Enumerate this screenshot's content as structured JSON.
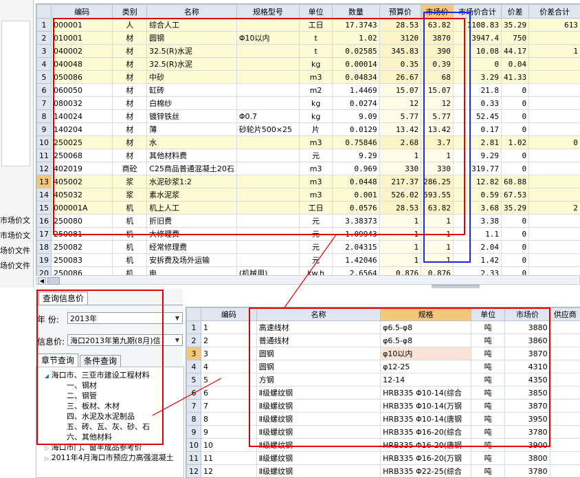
{
  "left_panel": {
    "file_labels": [
      "市场价文",
      "市场价文",
      "场价文件",
      "场价文件"
    ]
  },
  "main_grid": {
    "headers": [
      "编码",
      "类别",
      "名称",
      "规格型号",
      "单位",
      "数量",
      "预算价",
      "市场价",
      "市场价合计",
      "价差",
      "价差合计"
    ],
    "rows": [
      {
        "no": "1",
        "code": "000001",
        "cat": "人",
        "name": "综合人工",
        "spec": "",
        "unit": "工日",
        "qty": "17.3743",
        "budget": "28.53",
        "market": "63.82",
        "market_total": "1108.83",
        "diff": "35.29",
        "diff_total": "613"
      },
      {
        "no": "2",
        "code": "010001",
        "cat": "材",
        "name": "圆钢",
        "spec": "Φ10以内",
        "unit": "t",
        "qty": "1.02",
        "budget": "3120",
        "market": "3870",
        "market_total": "3947.4",
        "diff": "750",
        "diff_total": ""
      },
      {
        "no": "3",
        "code": "040002",
        "cat": "材",
        "name": "32.5(R)水泥",
        "spec": "",
        "unit": "t",
        "qty": "0.02585",
        "budget": "345.83",
        "market": "390",
        "market_total": "10.08",
        "diff": "44.17",
        "diff_total": "1"
      },
      {
        "no": "4",
        "code": "040048",
        "cat": "材",
        "name": "32.5(R)水泥",
        "spec": "",
        "unit": "kg",
        "qty": "0.00014",
        "budget": "0.35",
        "market": "0.39",
        "market_total": "0",
        "diff": "0.04",
        "diff_total": ""
      },
      {
        "no": "5",
        "code": "050086",
        "cat": "材",
        "name": "中砂",
        "spec": "",
        "unit": "m3",
        "qty": "0.04834",
        "budget": "26.67",
        "market": "68",
        "market_total": "3.29",
        "diff": "41.33",
        "diff_total": ""
      },
      {
        "no": "6",
        "code": "060050",
        "cat": "材",
        "name": "缸砖",
        "spec": "",
        "unit": "m2",
        "qty": "1.4469",
        "budget": "15.07",
        "market": "15.07",
        "market_total": "21.8",
        "diff": "0",
        "diff_total": ""
      },
      {
        "no": "7",
        "code": "080032",
        "cat": "材",
        "name": "白棉纱",
        "spec": "",
        "unit": "kg",
        "qty": "0.0274",
        "budget": "12",
        "market": "12",
        "market_total": "0.33",
        "diff": "0",
        "diff_total": ""
      },
      {
        "no": "8",
        "code": "140024",
        "cat": "材",
        "name": "镀锌铁丝",
        "spec": "Φ0.7",
        "unit": "kg",
        "qty": "9.09",
        "budget": "5.77",
        "market": "5.77",
        "market_total": "52.45",
        "diff": "0",
        "diff_total": ""
      },
      {
        "no": "9",
        "code": "140204",
        "cat": "材",
        "name": "薄",
        "spec": "砂轮片500×25",
        "unit": "片",
        "qty": "0.0129",
        "budget": "13.42",
        "market": "13.42",
        "market_total": "0.17",
        "diff": "0",
        "diff_total": ""
      },
      {
        "no": "10",
        "code": "250025",
        "cat": "材",
        "name": "水",
        "spec": "",
        "unit": "m3",
        "qty": "0.75846",
        "budget": "2.68",
        "market": "3.7",
        "market_total": "2.81",
        "diff": "1.02",
        "diff_total": "0"
      },
      {
        "no": "11",
        "code": "250068",
        "cat": "材",
        "name": "其他材料费",
        "spec": "",
        "unit": "元",
        "qty": "9.29",
        "budget": "1",
        "market": "1",
        "market_total": "9.29",
        "diff": "0",
        "diff_total": ""
      },
      {
        "no": "12",
        "code": "402019",
        "cat": "商砼",
        "name": "C25商品普通混凝土20石",
        "spec": "",
        "unit": "m3",
        "qty": "0.969",
        "budget": "330",
        "market": "330",
        "market_total": "319.77",
        "diff": "0",
        "diff_total": ""
      },
      {
        "no": "13",
        "code": "405002",
        "cat": "浆",
        "name": "水泥砂浆1:2",
        "spec": "",
        "unit": "m3",
        "qty": "0.0448",
        "budget": "217.37",
        "market": "286.25",
        "market_total": "12.82",
        "diff": "68.88",
        "diff_total": ""
      },
      {
        "no": "14",
        "code": "405032",
        "cat": "浆",
        "name": "素水泥浆",
        "spec": "",
        "unit": "m3",
        "qty": "0.001",
        "budget": "526.02",
        "market": "593.55",
        "market_total": "0.59",
        "diff": "67.53",
        "diff_total": ""
      },
      {
        "no": "15",
        "code": "000001A",
        "cat": "机",
        "name": "机上人工",
        "spec": "",
        "unit": "工日",
        "qty": "0.0576",
        "budget": "28.53",
        "market": "63.82",
        "market_total": "3.68",
        "diff": "35.29",
        "diff_total": "2"
      },
      {
        "no": "16",
        "code": "250080",
        "cat": "机",
        "name": "折旧费",
        "spec": "",
        "unit": "元",
        "qty": "3.38373",
        "budget": "1",
        "market": "1",
        "market_total": "3.38",
        "diff": "0",
        "diff_total": ""
      },
      {
        "no": "17",
        "code": "250081",
        "cat": "机",
        "name": "大修理费",
        "spec": "",
        "unit": "元",
        "qty": "1.09943",
        "budget": "1",
        "market": "1",
        "market_total": "1.1",
        "diff": "0",
        "diff_total": ""
      },
      {
        "no": "18",
        "code": "250082",
        "cat": "机",
        "name": "经常修理费",
        "spec": "",
        "unit": "元",
        "qty": "2.04315",
        "budget": "1",
        "market": "1",
        "market_total": "2.04",
        "diff": "0",
        "diff_total": ""
      },
      {
        "no": "19",
        "code": "250083",
        "cat": "机",
        "name": "安拆费及场外运输",
        "spec": "",
        "unit": "元",
        "qty": "1.42046",
        "budget": "1",
        "market": "1",
        "market_total": "1.42",
        "diff": "0",
        "diff_total": ""
      },
      {
        "no": "20",
        "code": "250086",
        "cat": "机",
        "name": "电",
        "spec": "(机械用)",
        "unit": "kw.h",
        "qty": "2.6564",
        "budget": "0.876",
        "market": "0.876",
        "market_total": "2.33",
        "diff": "0",
        "diff_total": ""
      }
    ]
  },
  "query_panel": {
    "tab_label": "查询信息价",
    "year_label": "年  份:",
    "year_value": "2013年",
    "info_label": "信息价:",
    "info_value": "海口2013年第九期(8月)信",
    "subtabs": [
      "章节查询",
      "条件查询"
    ],
    "tree": {
      "root": "海口市、三亚市建设工程材料",
      "children": [
        "一、钢材",
        "二、钢管",
        "三、板材、木材",
        "四、水泥及水泥制品",
        "五、砖、瓦、灰、砂、石",
        "六、其他材料"
      ],
      "siblings": [
        "海口市门、窗半成品参考价",
        "2011年4月海口市预应力高强混凝土"
      ]
    }
  },
  "detail_grid": {
    "headers": [
      "编码",
      "名称",
      "规格",
      "单位",
      "市场价",
      "供应商"
    ],
    "rows": [
      {
        "no": "1",
        "code": "1",
        "name": "高速线材",
        "spec": "φ6.5-φ8",
        "unit": "吨",
        "price": "3880"
      },
      {
        "no": "2",
        "code": "2",
        "name": "普通线材",
        "spec": "φ6.5-φ8",
        "unit": "吨",
        "price": "3860"
      },
      {
        "no": "3",
        "code": "3",
        "name": "圆钢",
        "spec": "φ10以内",
        "unit": "吨",
        "price": "3870"
      },
      {
        "no": "4",
        "code": "4",
        "name": "圆钢",
        "spec": "φ12-25",
        "unit": "吨",
        "price": "4310"
      },
      {
        "no": "5",
        "code": "5",
        "name": "方钢",
        "spec": "12-14",
        "unit": "吨",
        "price": "4350"
      },
      {
        "no": "6",
        "code": "6",
        "name": "Ⅱ级螺纹钢",
        "spec": "HRB335 Φ10-14(综合",
        "unit": "吨",
        "price": "3850"
      },
      {
        "no": "7",
        "code": "7",
        "name": "Ⅱ级螺纹钢",
        "spec": "HRB335 Φ10-14(万钢",
        "unit": "吨",
        "price": "3870"
      },
      {
        "no": "8",
        "code": "8",
        "name": "Ⅱ级螺纹钢",
        "spec": "HRB335 Φ10-14(唐钢",
        "unit": "吨",
        "price": "3950"
      },
      {
        "no": "9",
        "code": "9",
        "name": "Ⅱ级螺纹钢",
        "spec": "HRB335 Φ16-20(综合",
        "unit": "吨",
        "price": "3780"
      },
      {
        "no": "10",
        "code": "10",
        "name": "Ⅱ级螺纹钢",
        "spec": "HRB335 Φ16-20(唐钢",
        "unit": "吨",
        "price": "3900"
      },
      {
        "no": "11",
        "code": "11",
        "name": "Ⅱ级螺纹钢",
        "spec": "HRB335 Φ16-20(万钢",
        "unit": "吨",
        "price": "3800"
      },
      {
        "no": "12",
        "code": "12",
        "name": "Ⅱ级螺纹钢",
        "spec": "HRB335 Φ22-25(综合",
        "unit": "吨",
        "price": "3780"
      }
    ]
  },
  "colors": {
    "highlight_header": "#f5c77a",
    "annotation_red": "#e00000",
    "annotation_blue": "#1a2bd6",
    "row_yellow": "#fdfbd3"
  }
}
